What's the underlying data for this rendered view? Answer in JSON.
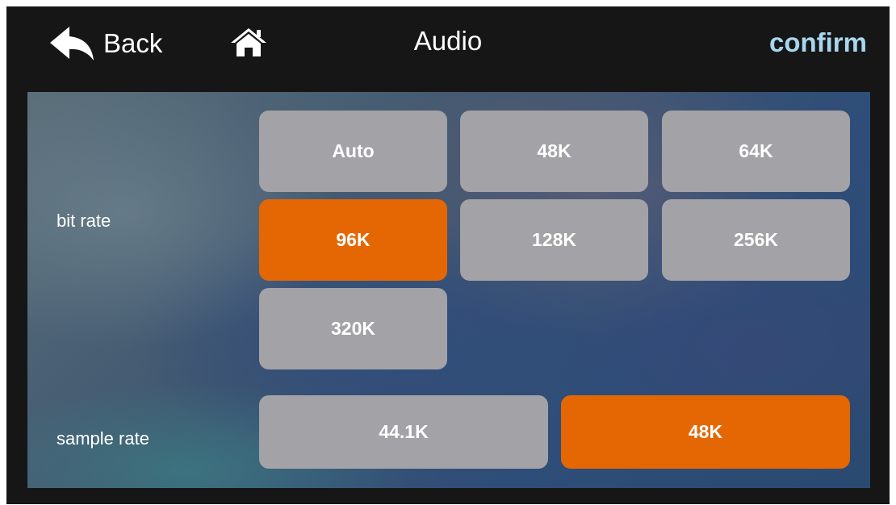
{
  "header": {
    "back_label": "Back",
    "title": "Audio",
    "confirm_label": "confirm",
    "icons": {
      "back": "back-arrow-icon",
      "home": "home-icon"
    }
  },
  "bit_rate": {
    "label": "bit rate",
    "options": [
      "Auto",
      "48K",
      "64K",
      "96K",
      "128K",
      "256K",
      "320K"
    ],
    "selected": "96K"
  },
  "sample_rate": {
    "label": "sample rate",
    "options": [
      "44.1K",
      "48K"
    ],
    "selected": "48K"
  },
  "colors": {
    "selected": "#e56703",
    "unselected": "#a3a2a6",
    "confirm": "#a8d6ee",
    "header_bg": "#161616"
  }
}
